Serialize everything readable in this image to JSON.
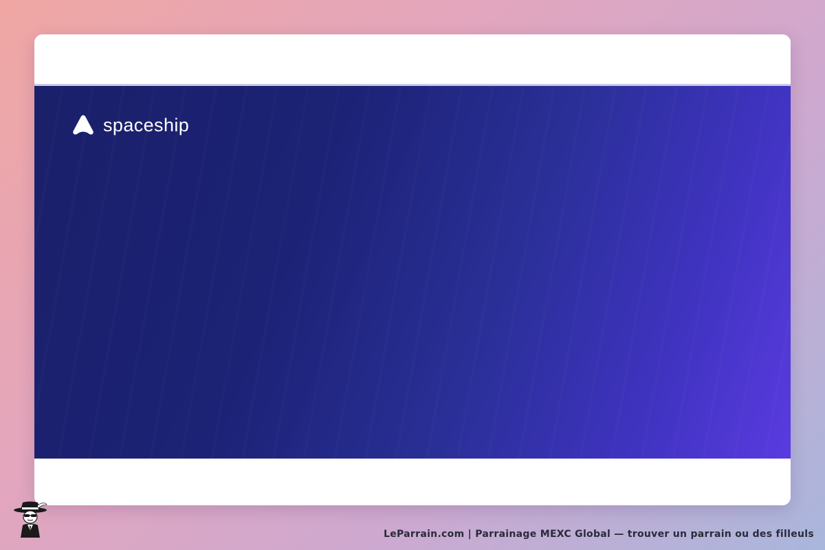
{
  "brand": {
    "name": "spaceship",
    "logo_icon": "spaceship-logo-icon"
  },
  "hero": {
    "gradient_start": "#1a2069",
    "gradient_end": "#5a3be0"
  },
  "footer": {
    "caption": "LeParrain.com | Parrainage MEXC Global — trouver un parrain ou des filleuls",
    "mascot_icon": "godfather-mascot-icon"
  },
  "colors": {
    "background_left": "#f0a7a3",
    "background_right": "#a9b6dc",
    "card": "#ffffff",
    "divider": "#c9cbe8"
  }
}
